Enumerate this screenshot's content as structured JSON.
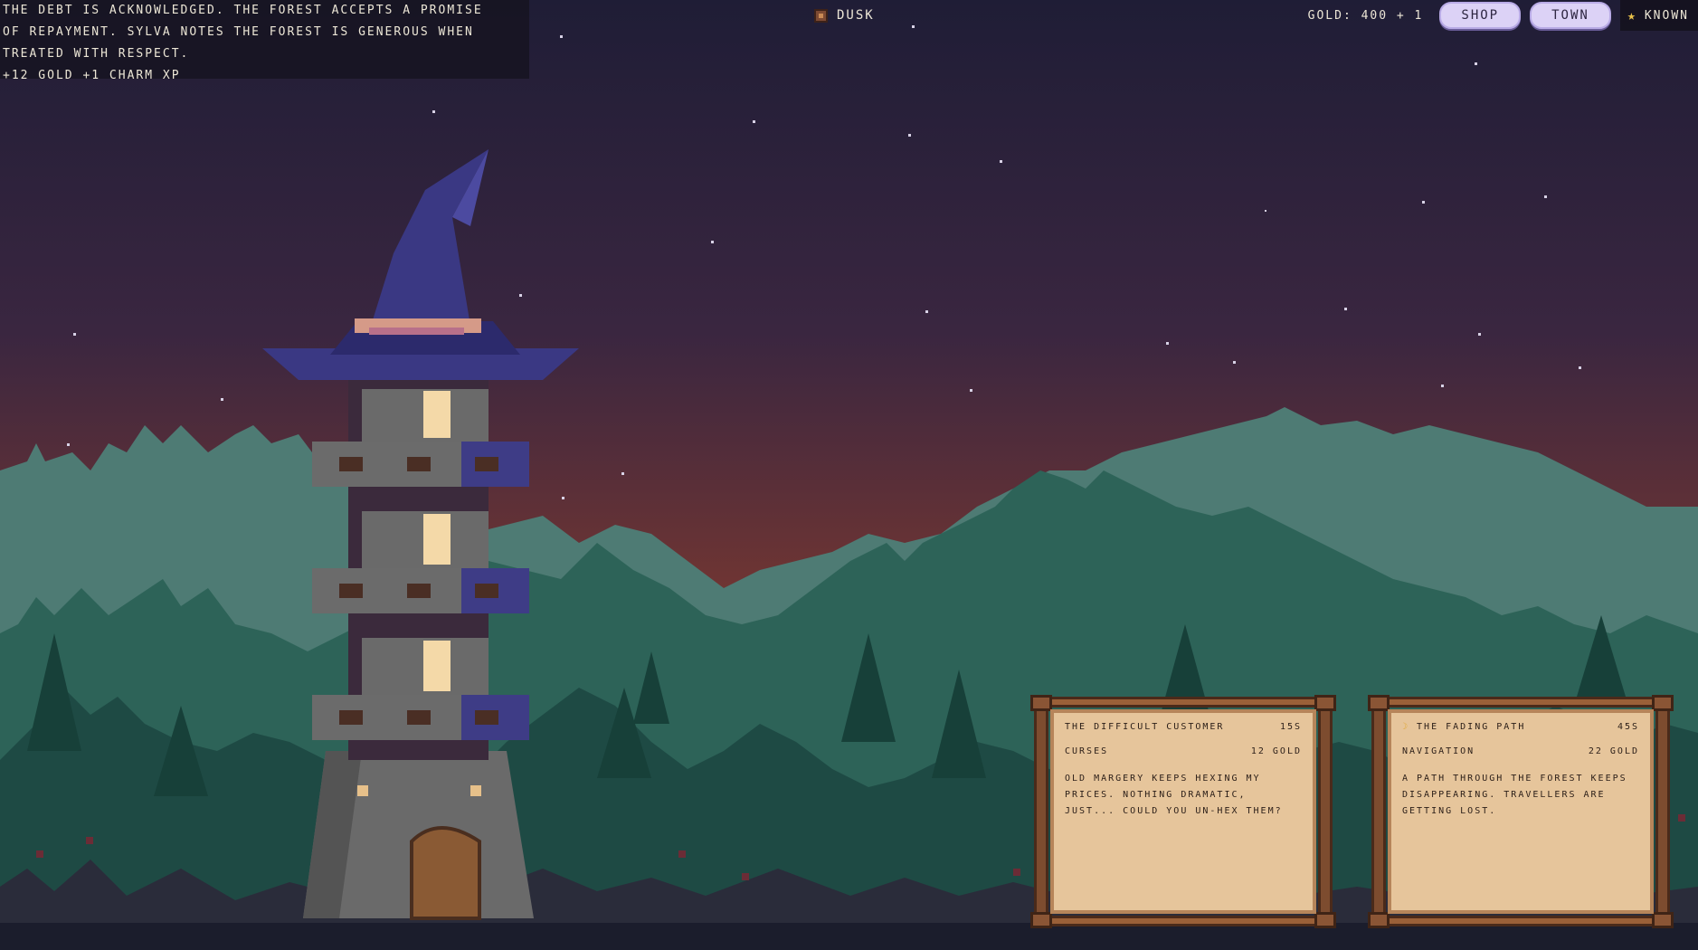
{
  "log": {
    "lines": [
      "THE DEBT IS ACKNOWLEDGED. THE FOREST ACCEPTS A PROMISE",
      "OF REPAYMENT. SYLVA NOTES THE FOREST IS GENEROUS WHEN",
      "TREATED WITH RESPECT.",
      "+12 GOLD  +1 CHARM XP"
    ]
  },
  "time": {
    "label": "DUSK",
    "icon": "clock-icon"
  },
  "hud": {
    "gold": "GOLD: 400 + 1",
    "shop_label": "SHOP",
    "town_label": "TOWN",
    "known_label": "KNOWN",
    "known_icon": "star-icon"
  },
  "quests": [
    {
      "title": "THE DIFFICULT CUSTOMER",
      "time": "15S",
      "skill": "CURSES",
      "reward": "12 GOLD",
      "description": "OLD MARGERY KEEPS HEXING MY PRICES. NOTHING DRAMATIC, JUST... COULD YOU UN-HEX THEM?"
    },
    {
      "icon": "moon-icon",
      "title": "THE FADING PATH",
      "time": "45S",
      "skill": "NAVIGATION",
      "reward": "22 GOLD",
      "description": "A PATH THROUGH THE FOREST KEEPS DISAPPEARING. TRAVELLERS ARE GETTING LOST."
    }
  ],
  "colors": {
    "sky_top": "#1f1d36",
    "sky_bottom": "#9e4a2c",
    "forest_far": "#4e7b74",
    "forest_mid": "#25574f",
    "forest_near": "#17403d",
    "hat": "#3a3883",
    "tower_stone": "#6b6b6b",
    "paper": "#e6c59b",
    "wood": "#7d4c2f"
  }
}
